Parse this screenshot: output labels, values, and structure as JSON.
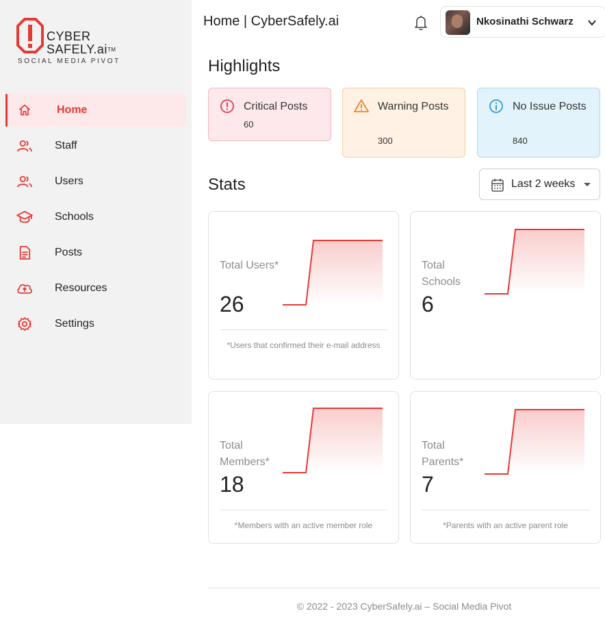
{
  "brand": {
    "line1": "CYBER",
    "line2": "SAFELY.ai",
    "tm": "TM",
    "subtitle": "SOCIAL MEDIA PIVOT",
    "accent_color": "#e53935"
  },
  "sidebar": {
    "items": [
      {
        "label": "Home",
        "icon": "home-icon",
        "active": true
      },
      {
        "label": "Staff",
        "icon": "people-icon",
        "active": false
      },
      {
        "label": "Users",
        "icon": "people-icon",
        "active": false
      },
      {
        "label": "Schools",
        "icon": "school-icon",
        "active": false
      },
      {
        "label": "Posts",
        "icon": "document-icon",
        "active": false
      },
      {
        "label": "Resources",
        "icon": "cloud-upload-icon",
        "active": false
      },
      {
        "label": "Settings",
        "icon": "gear-icon",
        "active": false
      }
    ]
  },
  "header": {
    "title": "Home | CyberSafely.ai",
    "notifications_icon": "bell-icon",
    "user": {
      "name": "Nkosinathi Schwarz",
      "avatar_icon": "avatar",
      "menu_icon": "chevron-down-icon"
    }
  },
  "highlights": {
    "title": "Highlights",
    "cards": [
      {
        "label": "Critical Posts",
        "count": "60",
        "icon": "error-circle-icon",
        "color": "#e53950"
      },
      {
        "label": "Warning Posts",
        "count": "300",
        "icon": "warning-triangle-icon",
        "color": "#e8862a"
      },
      {
        "label": "No Issue Posts",
        "count": "840",
        "icon": "info-circle-icon",
        "color": "#2e9bd6"
      }
    ]
  },
  "stats": {
    "title": "Stats",
    "range": {
      "label": "Last 2 weeks",
      "icon": "calendar-icon"
    },
    "cards": [
      {
        "label": "Total Users*",
        "value": "26",
        "note": "*Users that confirmed their e-mail address",
        "spark": [
          0,
          0,
          1,
          1,
          1
        ]
      },
      {
        "label": "Total Schools",
        "value": "6",
        "note": "",
        "spark": [
          0,
          0,
          1,
          1,
          1
        ]
      },
      {
        "label": "Total Members*",
        "value": "18",
        "note": "*Members with an active member role",
        "spark": [
          0,
          0,
          1,
          1,
          1
        ]
      },
      {
        "label": "Total Parents*",
        "value": "7",
        "note": "*Parents with an active parent role",
        "spark": [
          0,
          0,
          1,
          1,
          1
        ]
      }
    ],
    "line_color": "#e53935"
  },
  "footer": {
    "text": "© 2022 - 2023 CyberSafely.ai – Social Media Pivot"
  }
}
